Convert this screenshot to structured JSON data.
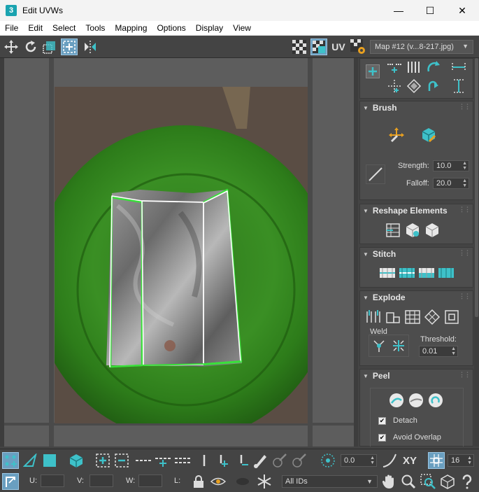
{
  "window": {
    "title": "Edit UVWs",
    "app_icon": "3",
    "minimize": "—",
    "maximize": "☐",
    "close": "✕"
  },
  "menus": [
    "File",
    "Edit",
    "Select",
    "Tools",
    "Mapping",
    "Options",
    "Display",
    "View"
  ],
  "toolbar": {
    "uv_label": "UV",
    "map_select": "Map #12 (v...8-217.jpg)"
  },
  "panel": {
    "brush": {
      "title": "Brush",
      "strength_label": "Strength:",
      "strength": "10.0",
      "falloff_label": "Falloff:",
      "falloff": "20.0"
    },
    "reshape": {
      "title": "Reshape Elements"
    },
    "stitch": {
      "title": "Stitch"
    },
    "explode": {
      "title": "Explode",
      "weld_label": "Weld",
      "threshold_label": "Threshold:",
      "threshold": "0.01"
    },
    "peel": {
      "title": "Peel",
      "detach_label": "Detach",
      "detach_checked": "✔",
      "avoid_overlap_label": "Avoid Overlap",
      "avoid_overlap_checked": "✔"
    }
  },
  "bottom": {
    "rotation_value": "0.0",
    "xy_label": "XY",
    "grid_value": "16",
    "u_label": "U:",
    "v_label": "V:",
    "w_label": "W:",
    "l_label": "L:",
    "ids_select": "All IDs"
  },
  "colors": {
    "accent": "#3ec1c9",
    "panel_bg": "#444444",
    "viewport_bg": "#5d5d5d",
    "uv_edge": "#ffffff",
    "uv_edge_selected": "#39e03a"
  }
}
